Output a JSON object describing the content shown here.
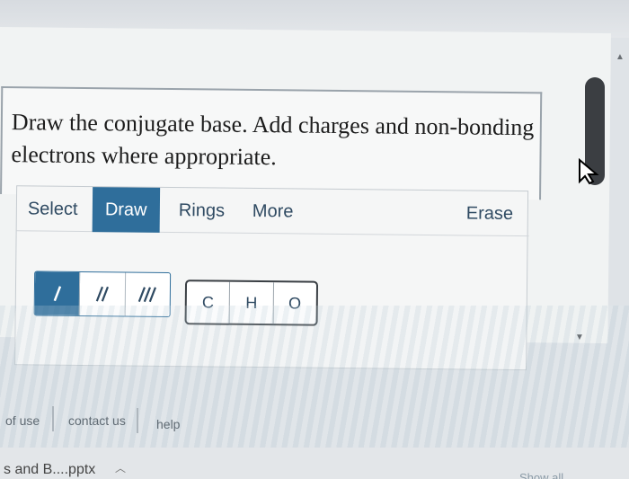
{
  "question": {
    "prompt": "Draw the conjugate base. Add charges and non-bonding electrons where appropriate."
  },
  "tabs": [
    {
      "label": "Select",
      "active": false
    },
    {
      "label": "Draw",
      "active": true
    },
    {
      "label": "Rings",
      "active": false
    },
    {
      "label": "More",
      "active": false
    }
  ],
  "erase_label": "Erase",
  "bond_tools": [
    {
      "icon": "single-bond-icon",
      "active": true
    },
    {
      "icon": "double-bond-icon",
      "active": false
    },
    {
      "icon": "triple-bond-icon",
      "active": false
    }
  ],
  "atoms": [
    "C",
    "H",
    "O"
  ],
  "footer": {
    "links": [
      "of use",
      "contact us",
      "help"
    ]
  },
  "downloads": {
    "file": "s and B....pptx",
    "show_all": "Show all"
  },
  "colors": {
    "accent": "#2f6e9b",
    "text": "#2f4a62"
  }
}
